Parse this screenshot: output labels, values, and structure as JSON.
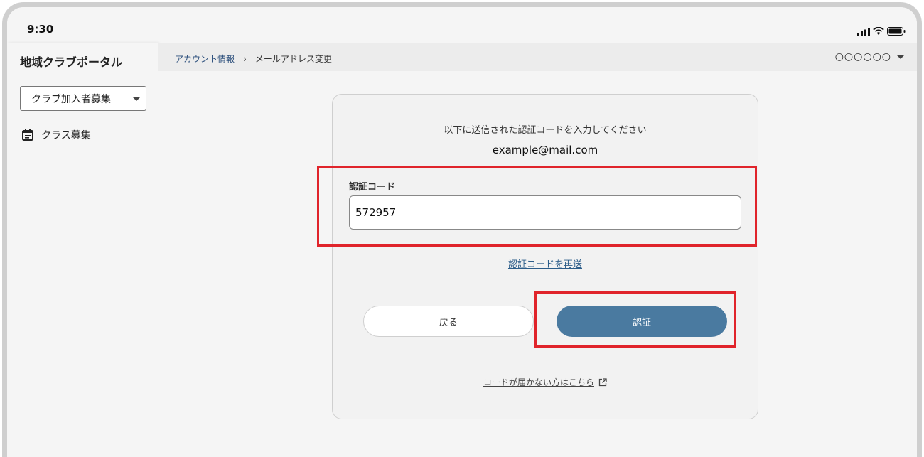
{
  "status_bar": {
    "time": "9:30"
  },
  "sidebar": {
    "title": "地域クラブポータル",
    "select_value": "クラブ加入者募集",
    "items": [
      {
        "label": "クラス募集",
        "icon": "calendar-icon"
      }
    ]
  },
  "topbar": {
    "breadcrumb": [
      {
        "label": "アカウント情報"
      },
      {
        "label": "メールアドレス変更"
      }
    ],
    "user_name": "○○○○○○"
  },
  "card": {
    "instruction": "以下に送信された認証コードを入力してください",
    "email": "example@mail.com",
    "code_label": "認証コード",
    "code_value": "572957",
    "resend_label": "認証コードを再送",
    "back_label": "戻る",
    "verify_label": "認証",
    "help_label": "コードが届かない方はこちら"
  },
  "colors": {
    "accent": "#4a7aa0",
    "highlight": "#e0242b",
    "link": "#2c5d8a"
  }
}
